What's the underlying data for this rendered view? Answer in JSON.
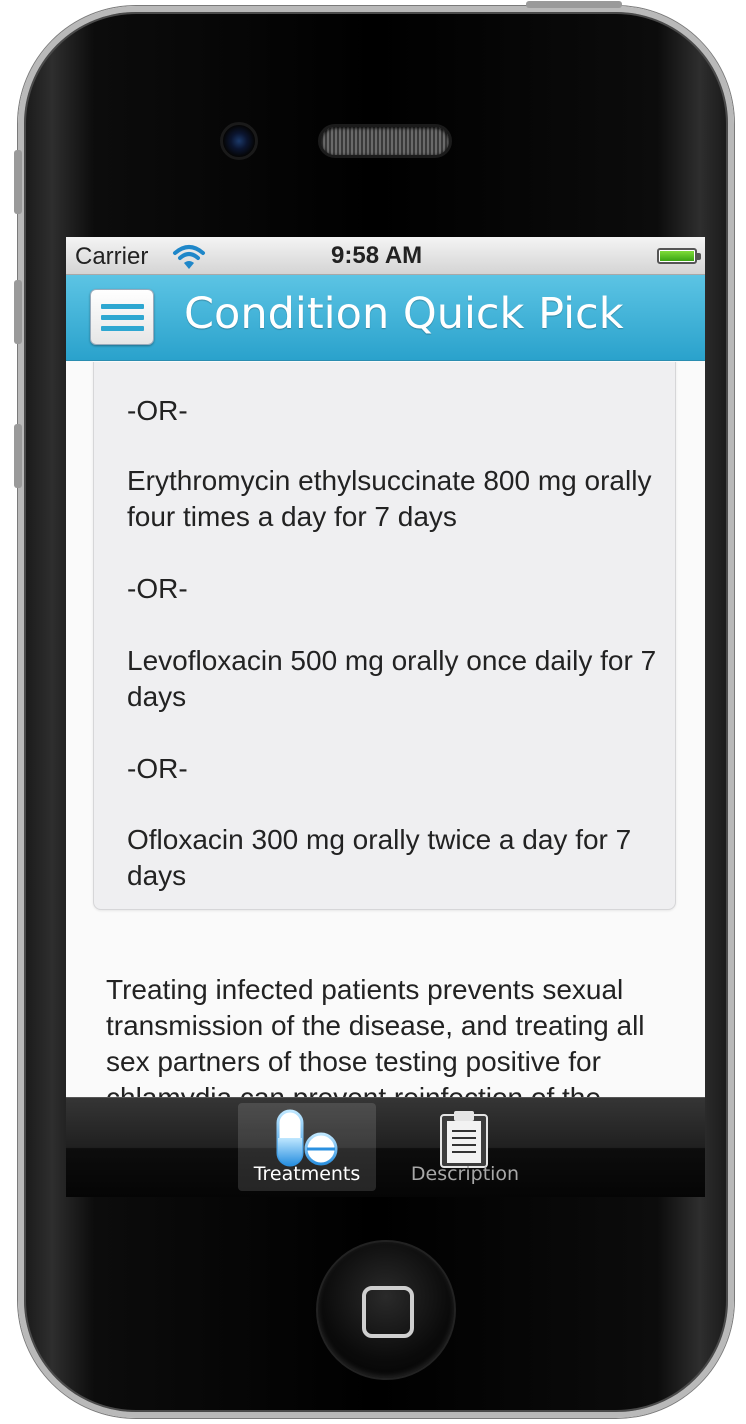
{
  "status_bar": {
    "carrier": "Carrier",
    "time": "9:58 AM",
    "wifi_icon": "wifi-icon",
    "battery_icon": "battery-icon"
  },
  "nav_bar": {
    "title": "Condition Quick Pick",
    "menu_icon": "hamburger-menu-icon",
    "accent_color": "#35aed6"
  },
  "treatment_card": {
    "items": [
      "-OR-",
      "Erythromycin ethylsuccinate 800 mg orally four times a day for 7 days",
      "-OR-",
      "Levofloxacin 500 mg orally once daily for 7 days",
      "-OR-",
      "Ofloxacin 300 mg orally twice a day for 7 days"
    ]
  },
  "description": {
    "text": "Treating infected patients prevents sexual transmission of the disease, and treating all sex partners of those testing positive for chlamydia can prevent reinfection of the"
  },
  "tab_bar": {
    "tabs": [
      {
        "label": "Treatments",
        "icon": "pills-icon",
        "selected": true
      },
      {
        "label": "Description",
        "icon": "clipboard-icon",
        "selected": false
      }
    ]
  }
}
